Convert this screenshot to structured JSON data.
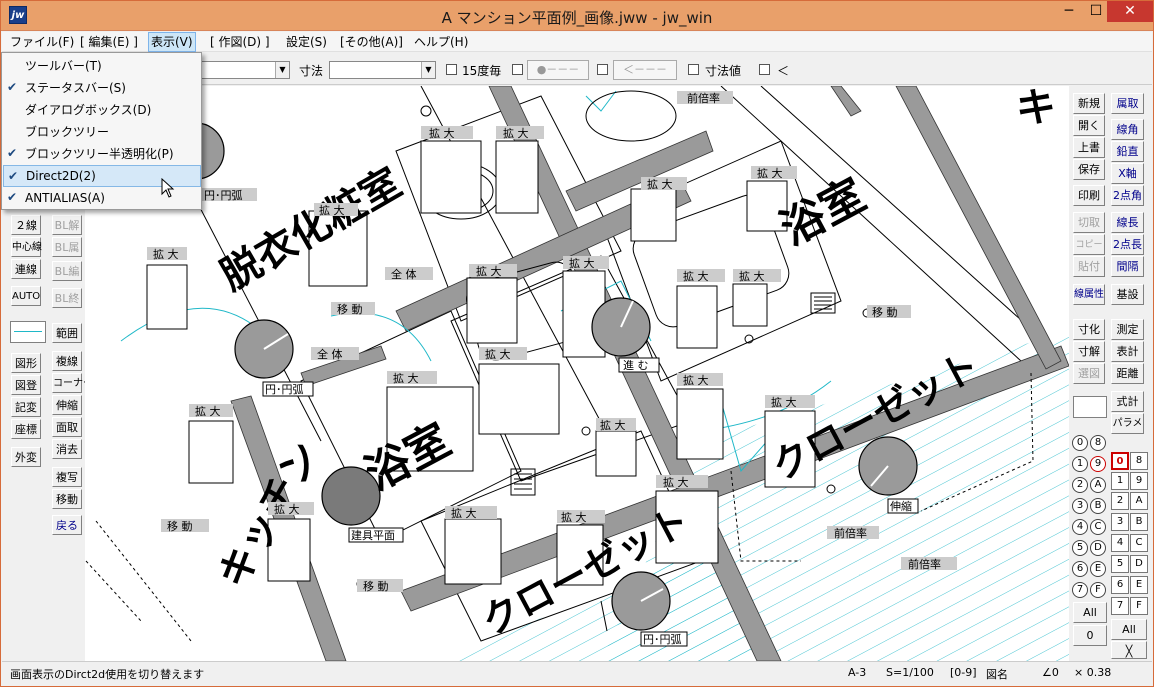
{
  "window": {
    "title": "A マンション平面例_画像.jww - jw_win",
    "app_icon": "jw",
    "min": "─",
    "max": "☐",
    "close": "✕"
  },
  "menu": [
    "ファイル(F)",
    "[ 編集(E) ]",
    "表示(V)",
    "[ 作図(D) ]",
    "設定(S)",
    "[その他(A)]",
    "ヘルプ(H)"
  ],
  "view_menu": {
    "items": [
      {
        "label": "ツールバー(T)",
        "checked": false
      },
      {
        "label": "ステータスバー(S)",
        "checked": true
      },
      {
        "label": "ダイアログボックス(D)",
        "checked": false
      },
      {
        "label": "ブロックツリー",
        "checked": false
      },
      {
        "label": "ブロックツリー半透明化(P)",
        "checked": true
      },
      {
        "label": "Direct2D(2)",
        "checked": true
      },
      {
        "label": "ANTIALIAS(A)",
        "checked": true
      }
    ],
    "check_mark": "✔"
  },
  "toolbar": {
    "dim_label": "寸法",
    "deg15_label": "15度毎",
    "btn_circle": "●－－－",
    "btn_arrow": "＜－－－",
    "dimval_label": "寸法値",
    "lt_label": "＜"
  },
  "left_tools": [
    "２線",
    "中心線",
    "連線",
    "AUTO",
    "BL解",
    "BL属",
    "BL編",
    "BL終",
    "範囲",
    "複線",
    "コーナー",
    "伸縮",
    "面取",
    "消去",
    "複写",
    "移動",
    "戻る",
    "図形",
    "図登",
    "記変",
    "座標",
    "外変"
  ],
  "right_tools": [
    "新規",
    "属取",
    "開く",
    "線角",
    "上書",
    "鉛直",
    "保存",
    "X軸",
    "印刷",
    "2点角",
    "切取",
    "線長",
    "コピー",
    "2点長",
    "貼付",
    "間隔",
    "線属性",
    "基設",
    "寸化",
    "測定",
    "寸解",
    "表計",
    "選図",
    "距離",
    "式計",
    "パラメ"
  ],
  "layers": [
    "0",
    "1",
    "2",
    "3",
    "4",
    "5",
    "6",
    "7",
    "8",
    "9",
    "A",
    "B",
    "C",
    "D",
    "E",
    "F"
  ],
  "groups": [
    "0",
    "8",
    "1",
    "9",
    "2",
    "A",
    "3",
    "B",
    "4",
    "C",
    "5",
    "D",
    "6",
    "E",
    "7",
    "F"
  ],
  "all_label": "All",
  "zero_label": "0",
  "drawing": {
    "rooms": [
      "脱衣化粧室",
      "浴室",
      "浴室",
      "クローゼット",
      "クローゼット",
      "キッチン"
    ],
    "tags": [
      "拡 大",
      "移 動",
      "全 体",
      "前倍率",
      "円･円弧",
      "進 む",
      "建具平面",
      "伸縮"
    ]
  },
  "status": {
    "message": "画面表示のDirct2d使用を切り替えます",
    "paper": "A-3",
    "scale": "S=1/100",
    "layer": "[0-9]",
    "layer_name": "図名",
    "angle": "∠0",
    "ratio": "× 0.38"
  },
  "colors": {
    "titlebar": "#e9a06a",
    "close": "#c7372f",
    "cyan": "#1fb8c8",
    "wall": "#9a9a9a"
  }
}
